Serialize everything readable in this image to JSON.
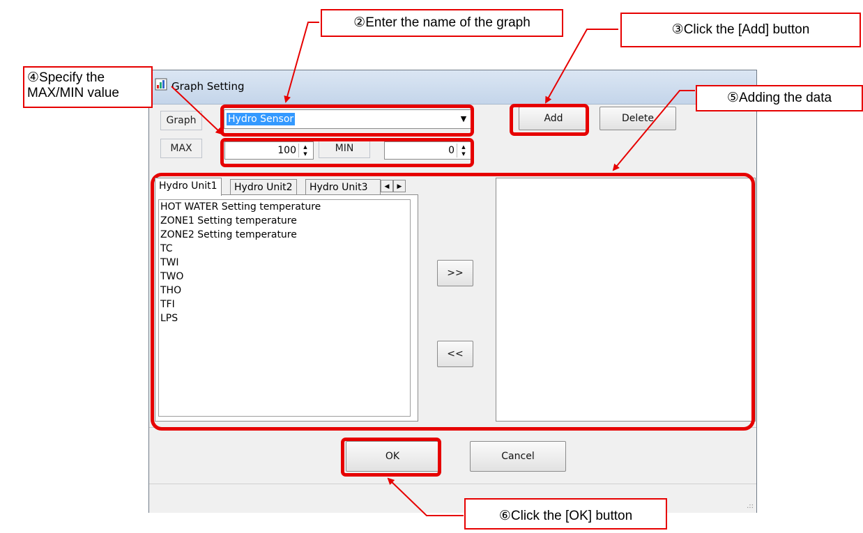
{
  "dialog": {
    "title": "Graph Setting",
    "graph_label": "Graph",
    "graph_value": "Hydro Sensor",
    "max_label": "MAX",
    "max_value": "100",
    "min_label": "MIN",
    "min_value": "0",
    "add_button": "Add",
    "delete_button": "Delete",
    "tabs": [
      "Hydro Unit1",
      "Hydro Unit2",
      "Hydro Unit3"
    ],
    "items": [
      "HOT WATER Setting temperature",
      "ZONE1 Setting temperature",
      "ZONE2 Setting temperature",
      "TC",
      "TWI",
      "TWO",
      "THO",
      "TFI",
      "LPS"
    ],
    "move_right_button": ">>",
    "move_left_button": "<<",
    "ok_button": "OK",
    "cancel_button": "Cancel"
  },
  "annotations": {
    "step2": "②Enter the name of the graph",
    "step3": "③Click the [Add] button",
    "step4_line1": "④Specify the",
    "step4_line2": "MAX/MIN value",
    "step5": "⑤Adding the data",
    "step6": "⑥Click the [OK] button"
  },
  "colors": {
    "annotation": "#e60000",
    "selection": "#3399ff"
  }
}
